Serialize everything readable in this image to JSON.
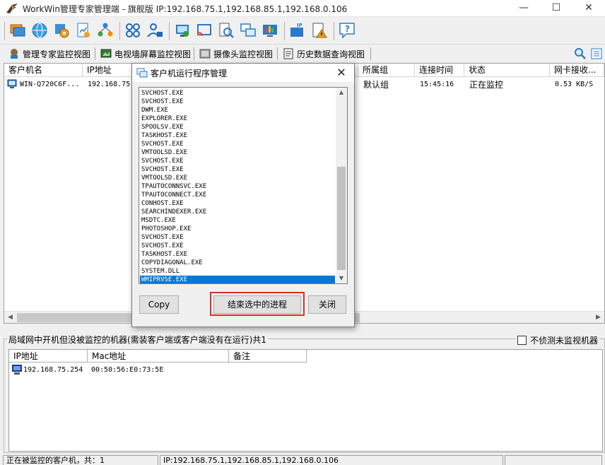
{
  "window": {
    "title": "WorkWin管理专家管理端 - 旗舰版 IP:192.168.75.1,192.168.85.1,192.168.0.106",
    "minimize": "—",
    "maximize": "☐",
    "close": "✕"
  },
  "toolbar": {
    "icons": [
      "screens-icon",
      "globe-icon",
      "settings-icon",
      "report-icon",
      "network-users-icon",
      "apps-icon",
      "user-lock-icon",
      "remote-desktop-icon",
      "cast-icon",
      "search-doc-icon",
      "windows-icon",
      "screen-record-icon",
      "ip-icon",
      "alert-icon",
      "help-icon"
    ]
  },
  "view_tabs": [
    {
      "label": "管理专家监控视图",
      "icon": "monitor-tree-icon"
    },
    {
      "label": "电视墙屏幕监控视图",
      "icon": "tv-wall-icon"
    },
    {
      "label": "摄像头监控视图",
      "icon": "camera-icon"
    },
    {
      "label": "历史数据查询视图",
      "icon": "history-icon"
    }
  ],
  "main_table": {
    "columns": [
      "客户机名",
      "IP地址",
      "所属组",
      "连接时间",
      "状态",
      "网卡接收..."
    ],
    "rows": [
      {
        "name": "WIN-Q720C6F...",
        "ip": "192.168.75...",
        "group": "默认组",
        "time": "15:45:16",
        "status": "正在监控",
        "rx": "0.53 KB/S"
      }
    ]
  },
  "dialog": {
    "title": "客户机运行程序管理",
    "close": "✕",
    "processes": [
      "SVCHOST.EXE",
      "SVCHOST.EXE",
      "DWM.EXE",
      "EXPLORER.EXE",
      "SPOOLSV.EXE",
      "TASKHOST.EXE",
      "SVCHOST.EXE",
      "VMTOOLSD.EXE",
      "SVCHOST.EXE",
      "SVCHOST.EXE",
      "VMTOOLSD.EXE",
      "TPAUTOCONNSVC.EXE",
      "TPAUTOCONNECT.EXE",
      "CONHOST.EXE",
      "SEARCHINDEXER.EXE",
      "MSDTC.EXE",
      "PHOTOSHOP.EXE",
      "SVCHOST.EXE",
      "SVCHOST.EXE",
      "TASKHOST.EXE",
      "COPYDIAGONAL.EXE",
      "SYSTEM.DLL",
      "WMIPRVSE.EXE"
    ],
    "selected_index": 22,
    "copy_label": "Copy",
    "kill_label": "结束选中的进程",
    "close_label": "关闭"
  },
  "lower": {
    "section_label": "局域网中开机但没被监控的机器(需装客户端或客户端没有在运行)共1",
    "no_detect_label": "不侦测未监视机器",
    "no_detect_checked": false,
    "columns": [
      "IP地址",
      "Mac地址",
      "备注"
    ],
    "rows": [
      {
        "ip": "192.168.75.254",
        "mac": "00:50:56:E0:73:5E",
        "note": ""
      }
    ]
  },
  "statusbar": {
    "monitored": "正在被监控的客户机，共：1",
    "ips": "IP:192.168.75.1,192.168.85.1,192.168.0.106"
  }
}
